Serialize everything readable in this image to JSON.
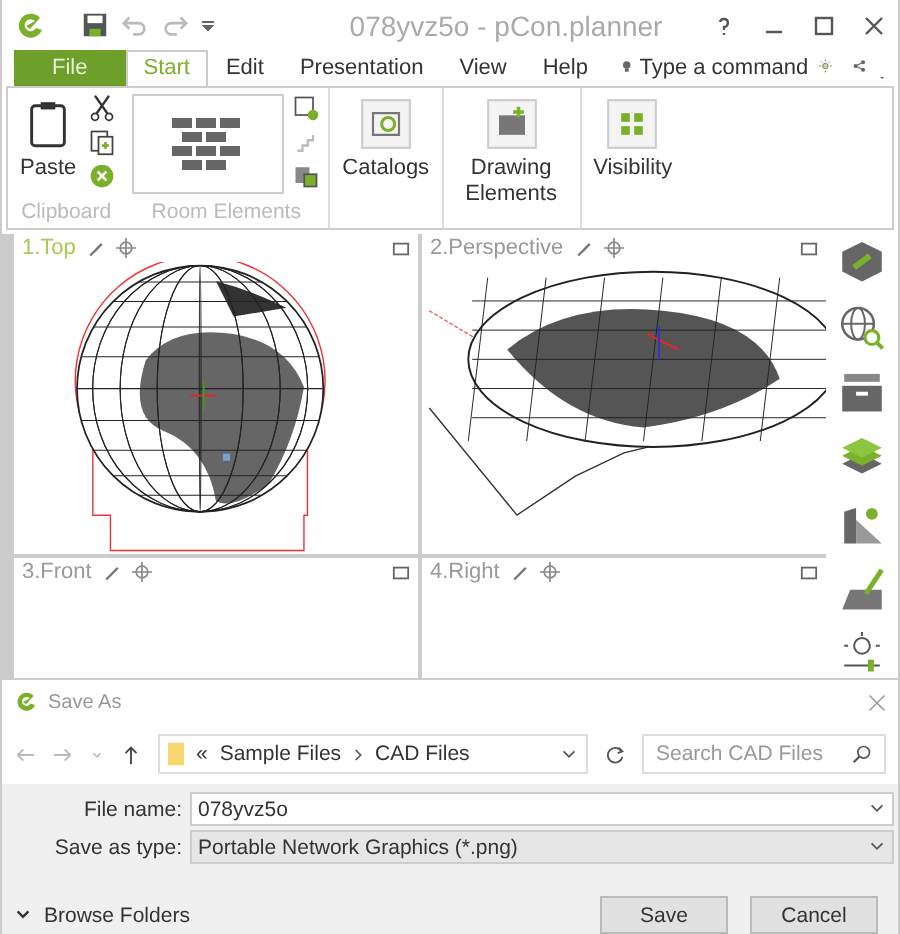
{
  "window": {
    "title": "078yvz5o - pCon.planner"
  },
  "tabs": [
    {
      "label": "File",
      "kind": "file",
      "selected": false
    },
    {
      "label": "Start",
      "kind": "tab",
      "selected": true
    },
    {
      "label": "Edit",
      "kind": "tab",
      "selected": false
    },
    {
      "label": "Presentation",
      "kind": "tab",
      "selected": false
    },
    {
      "label": "View",
      "kind": "tab",
      "selected": false
    },
    {
      "label": "Help",
      "kind": "tab",
      "selected": false
    }
  ],
  "command_search": {
    "placeholder": "Type a command"
  },
  "ribbon": {
    "paste": "Paste",
    "clipboard_group": "Clipboard",
    "room_group": "Room Elements",
    "catalogs": "Catalogs",
    "drawing_elements": "Drawing Elements",
    "visibility": "Visibility"
  },
  "viewports": [
    {
      "label": "1.Top",
      "kind": "top",
      "selected": true
    },
    {
      "label": "2.Perspective",
      "kind": "perspective",
      "selected": false
    },
    {
      "label": "3.Front",
      "kind": "empty",
      "selected": false
    },
    {
      "label": "4.Right",
      "kind": "empty",
      "selected": false
    }
  ],
  "dialog": {
    "title": "Save As",
    "path_prefix": "«",
    "path": [
      "Sample Files",
      "CAD Files"
    ],
    "search": {
      "placeholder": "Search CAD Files"
    },
    "file_name": {
      "label": "File name:",
      "value": "078yvz5o"
    },
    "save_as_type": {
      "label": "Save as type:",
      "value": "Portable Network Graphics (*.png)"
    },
    "browse_folders": "Browse Folders",
    "buttons": [
      "Save",
      "Cancel"
    ]
  }
}
